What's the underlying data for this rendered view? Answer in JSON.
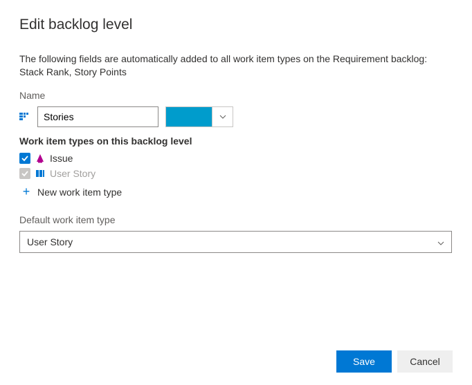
{
  "dialog": {
    "title": "Edit backlog level",
    "description": "The following fields are automatically added to all work item types on the Requirement backlog: Stack Rank, Story Points"
  },
  "name": {
    "label": "Name",
    "value": "Stories",
    "color": "#009ccc"
  },
  "wit_section": {
    "heading": "Work item types on this backlog level",
    "items": [
      {
        "label": "Issue",
        "checked": true,
        "locked": false,
        "icon": "issue-icon",
        "icon_color": "#b2008f"
      },
      {
        "label": "User Story",
        "checked": true,
        "locked": true,
        "icon": "user-story-icon",
        "icon_color": "#0078d4"
      }
    ],
    "new_label": "New work item type"
  },
  "default_section": {
    "label": "Default work item type",
    "value": "User Story"
  },
  "footer": {
    "save": "Save",
    "cancel": "Cancel"
  }
}
